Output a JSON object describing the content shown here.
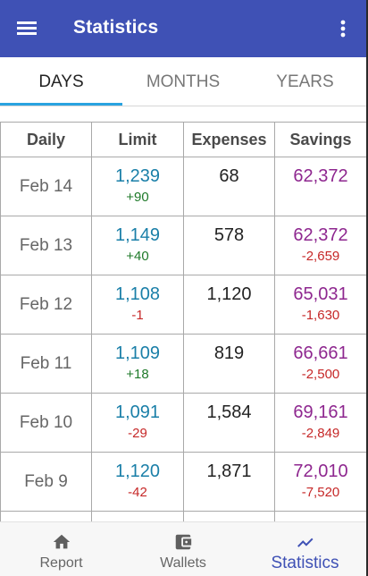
{
  "app_bar": {
    "title": "Statistics",
    "menu_icon": "menu-icon",
    "overflow_icon": "more-vert-icon"
  },
  "tabs": [
    {
      "label": "DAYS",
      "active": true
    },
    {
      "label": "MONTHS",
      "active": false
    },
    {
      "label": "YEARS",
      "active": false
    }
  ],
  "table": {
    "headers": [
      "Daily",
      "Limit",
      "Expenses",
      "Savings"
    ],
    "rows": [
      {
        "date": "Feb 14",
        "limit": "1,239",
        "limit_delta": "+90",
        "expenses": "68",
        "savings": "62,372",
        "savings_delta": ""
      },
      {
        "date": "Feb 13",
        "limit": "1,149",
        "limit_delta": "+40",
        "expenses": "578",
        "savings": "62,372",
        "savings_delta": "-2,659"
      },
      {
        "date": "Feb 12",
        "limit": "1,108",
        "limit_delta": "-1",
        "expenses": "1,120",
        "savings": "65,031",
        "savings_delta": "-1,630"
      },
      {
        "date": "Feb 11",
        "limit": "1,109",
        "limit_delta": "+18",
        "expenses": "819",
        "savings": "66,661",
        "savings_delta": "-2,500"
      },
      {
        "date": "Feb 10",
        "limit": "1,091",
        "limit_delta": "-29",
        "expenses": "1,584",
        "savings": "69,161",
        "savings_delta": "-2,849"
      },
      {
        "date": "Feb 9",
        "limit": "1,120",
        "limit_delta": "-42",
        "expenses": "1,871",
        "savings": "72,010",
        "savings_delta": "-7,520"
      }
    ]
  },
  "bottom_nav": [
    {
      "label": "Report",
      "icon": "home-icon",
      "active": false
    },
    {
      "label": "Wallets",
      "icon": "wallet-icon",
      "active": false
    },
    {
      "label": "Statistics",
      "icon": "trending-up-icon",
      "active": true
    }
  ],
  "colors": {
    "app_bar": "#3f51b5",
    "tab_indicator": "#29a3e0",
    "limit_value": "#1a7fa8",
    "savings_value": "#8e278f",
    "positive_delta": "#1f7a2a",
    "negative_delta": "#c62828"
  }
}
